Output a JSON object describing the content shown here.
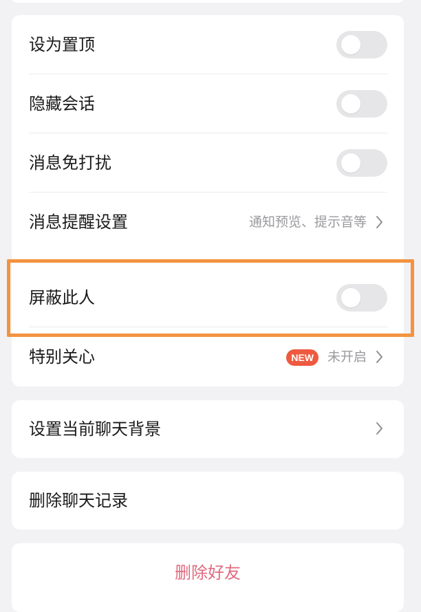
{
  "colors": {
    "page_background": "#f2f2f4",
    "card_background": "#ffffff",
    "toggle_off": "#e6e6e8",
    "hint_text": "#9a9a9e",
    "new_badge": "#ee5a3f",
    "delete_friend_text": "#e06a7e",
    "highlight_frame": "#f39341"
  },
  "settings": {
    "pin_top": {
      "label": "设为置顶",
      "enabled": false
    },
    "hide_chat": {
      "label": "隐藏会话",
      "enabled": false
    },
    "do_not_disturb": {
      "label": "消息免打扰",
      "enabled": false
    },
    "notification_settings": {
      "label": "消息提醒设置",
      "hint": "通知预览、提示音等"
    },
    "block_person": {
      "label": "屏蔽此人",
      "enabled": false
    },
    "special_care": {
      "label": "特别关心",
      "badge": "NEW",
      "status": "未开启"
    }
  },
  "background": {
    "label": "设置当前聊天背景"
  },
  "clear_history": {
    "label": "删除聊天记录"
  },
  "delete_friend": {
    "label": "删除好友"
  }
}
